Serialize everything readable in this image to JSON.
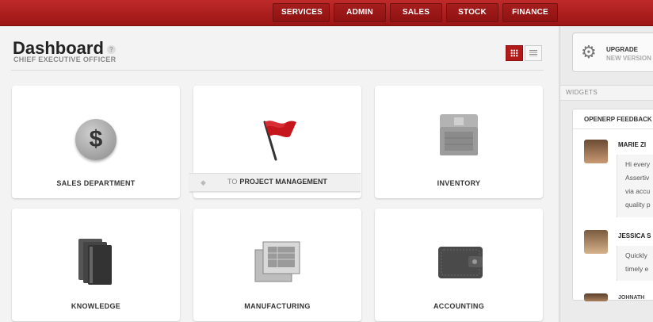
{
  "topnav": [
    "SERVICES",
    "ADMIN",
    "SALES",
    "STOCK",
    "FINANCE"
  ],
  "header": {
    "title": "Dashboard",
    "help": "?",
    "subtitle": "CHIEF EXECUTIVE OFFICER"
  },
  "tiles": {
    "sales": "SALES DEPARTMENT",
    "project_to": "TO",
    "project": "PROJECT MANAGEMENT",
    "inventory": "INVENTORY",
    "knowledge": "KNOWLEDGE",
    "manufacturing": "MANUFACTURING",
    "accounting": "ACCOUNTING"
  },
  "right": {
    "upgrade_title": "UPGRADE",
    "upgrade_sub": "NEW VERSION",
    "widgets": "WIDGETS",
    "feed_title": "OPENERP FEEDBACK",
    "feed": [
      {
        "name": "MARIE ZI",
        "lines": [
          "Hi every",
          "Assertiv",
          "via accu",
          "quality p"
        ]
      },
      {
        "name": "JESSICA S",
        "lines": [
          "Quickly",
          "timely e"
        ]
      },
      {
        "name": "JOHNATH"
      }
    ]
  },
  "colors": {
    "accent": "#b21a1a",
    "topbar": "#a81d1d"
  }
}
